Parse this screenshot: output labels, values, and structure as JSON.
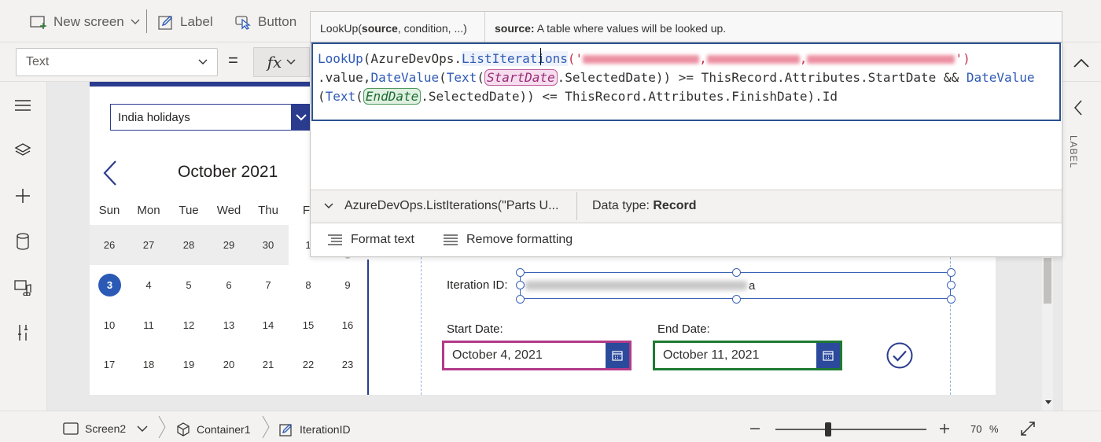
{
  "toolbar": {
    "new_screen_label": "New screen",
    "label_label": "Label",
    "button_label": "Button"
  },
  "formula_bar": {
    "property": "Text",
    "equals": "=",
    "fx": "fx",
    "hint_function": "LookUp(",
    "hint_param": "source",
    "hint_rest": ", condition, ...)",
    "hint_desc_param": "source:",
    "hint_desc_text": " A table where values will be looked up.",
    "code": {
      "l1_fn": "LookUp",
      "l1_a": "(AzureDevOps.",
      "l1_kw": "ListIterations",
      "l1_b": "('",
      "l1_c": ",",
      "l1_d": "')",
      "l2_a": ".value,",
      "l2_kw1": "DateValue",
      "l2_b": "(",
      "l2_kw2": "Text",
      "l2_c": "(",
      "l2_start": "StartDate",
      "l2_d": ".SelectedDate)) >= ThisRecord.Attributes.StartDate && ",
      "l2_kw3": "DateValue",
      "l3_a": "(",
      "l3_kw": "Text",
      "l3_b": "(",
      "l3_end": "EndDate",
      "l3_c": ".SelectedDate)) <= ThisRecord.Attributes.FinishDate).Id"
    },
    "result_expression": "AzureDevOps.ListIterations(\"Parts U...",
    "data_type_label": "Data type: ",
    "data_type_value": "Record",
    "format_text_label": "Format text",
    "remove_formatting_label": "Remove formatting"
  },
  "canvas": {
    "holiday_dropdown": "India holidays",
    "calendar": {
      "month": "October 2021",
      "day_names": [
        "Sun",
        "Mon",
        "Tue",
        "Wed",
        "Thu",
        "Fr"
      ],
      "weeks": [
        [
          "26",
          "27",
          "28",
          "29",
          "30",
          "1",
          ""
        ],
        [
          "3",
          "4",
          "5",
          "6",
          "7",
          "8",
          "9"
        ],
        [
          "10",
          "11",
          "12",
          "13",
          "14",
          "15",
          "16"
        ],
        [
          "17",
          "18",
          "19",
          "20",
          "21",
          "22",
          "23"
        ]
      ]
    },
    "iteration_label": "Iteration ID:",
    "iteration_value_tail": "a",
    "start_label": "Start Date:",
    "start_value": "October 4, 2021",
    "end_label": "End Date:",
    "end_value": "October 11, 2021"
  },
  "right_panel": {
    "label": "LABEL"
  },
  "status_bar": {
    "screen": "Screen2",
    "container": "Container1",
    "control": "IterationID",
    "zoom": "70",
    "zoom_unit": "%",
    "zoom_level": 0.35
  },
  "colors": {
    "accent_blue": "#2b3c8f",
    "start_date_border": "#b23a89",
    "end_date_border": "#1e7a32",
    "formula_border": "#2c5291"
  },
  "icons": {
    "left_rail": [
      "hamburger-icon",
      "layers-icon",
      "plus-icon",
      "database-icon",
      "media-icon",
      "tools-icon"
    ]
  }
}
